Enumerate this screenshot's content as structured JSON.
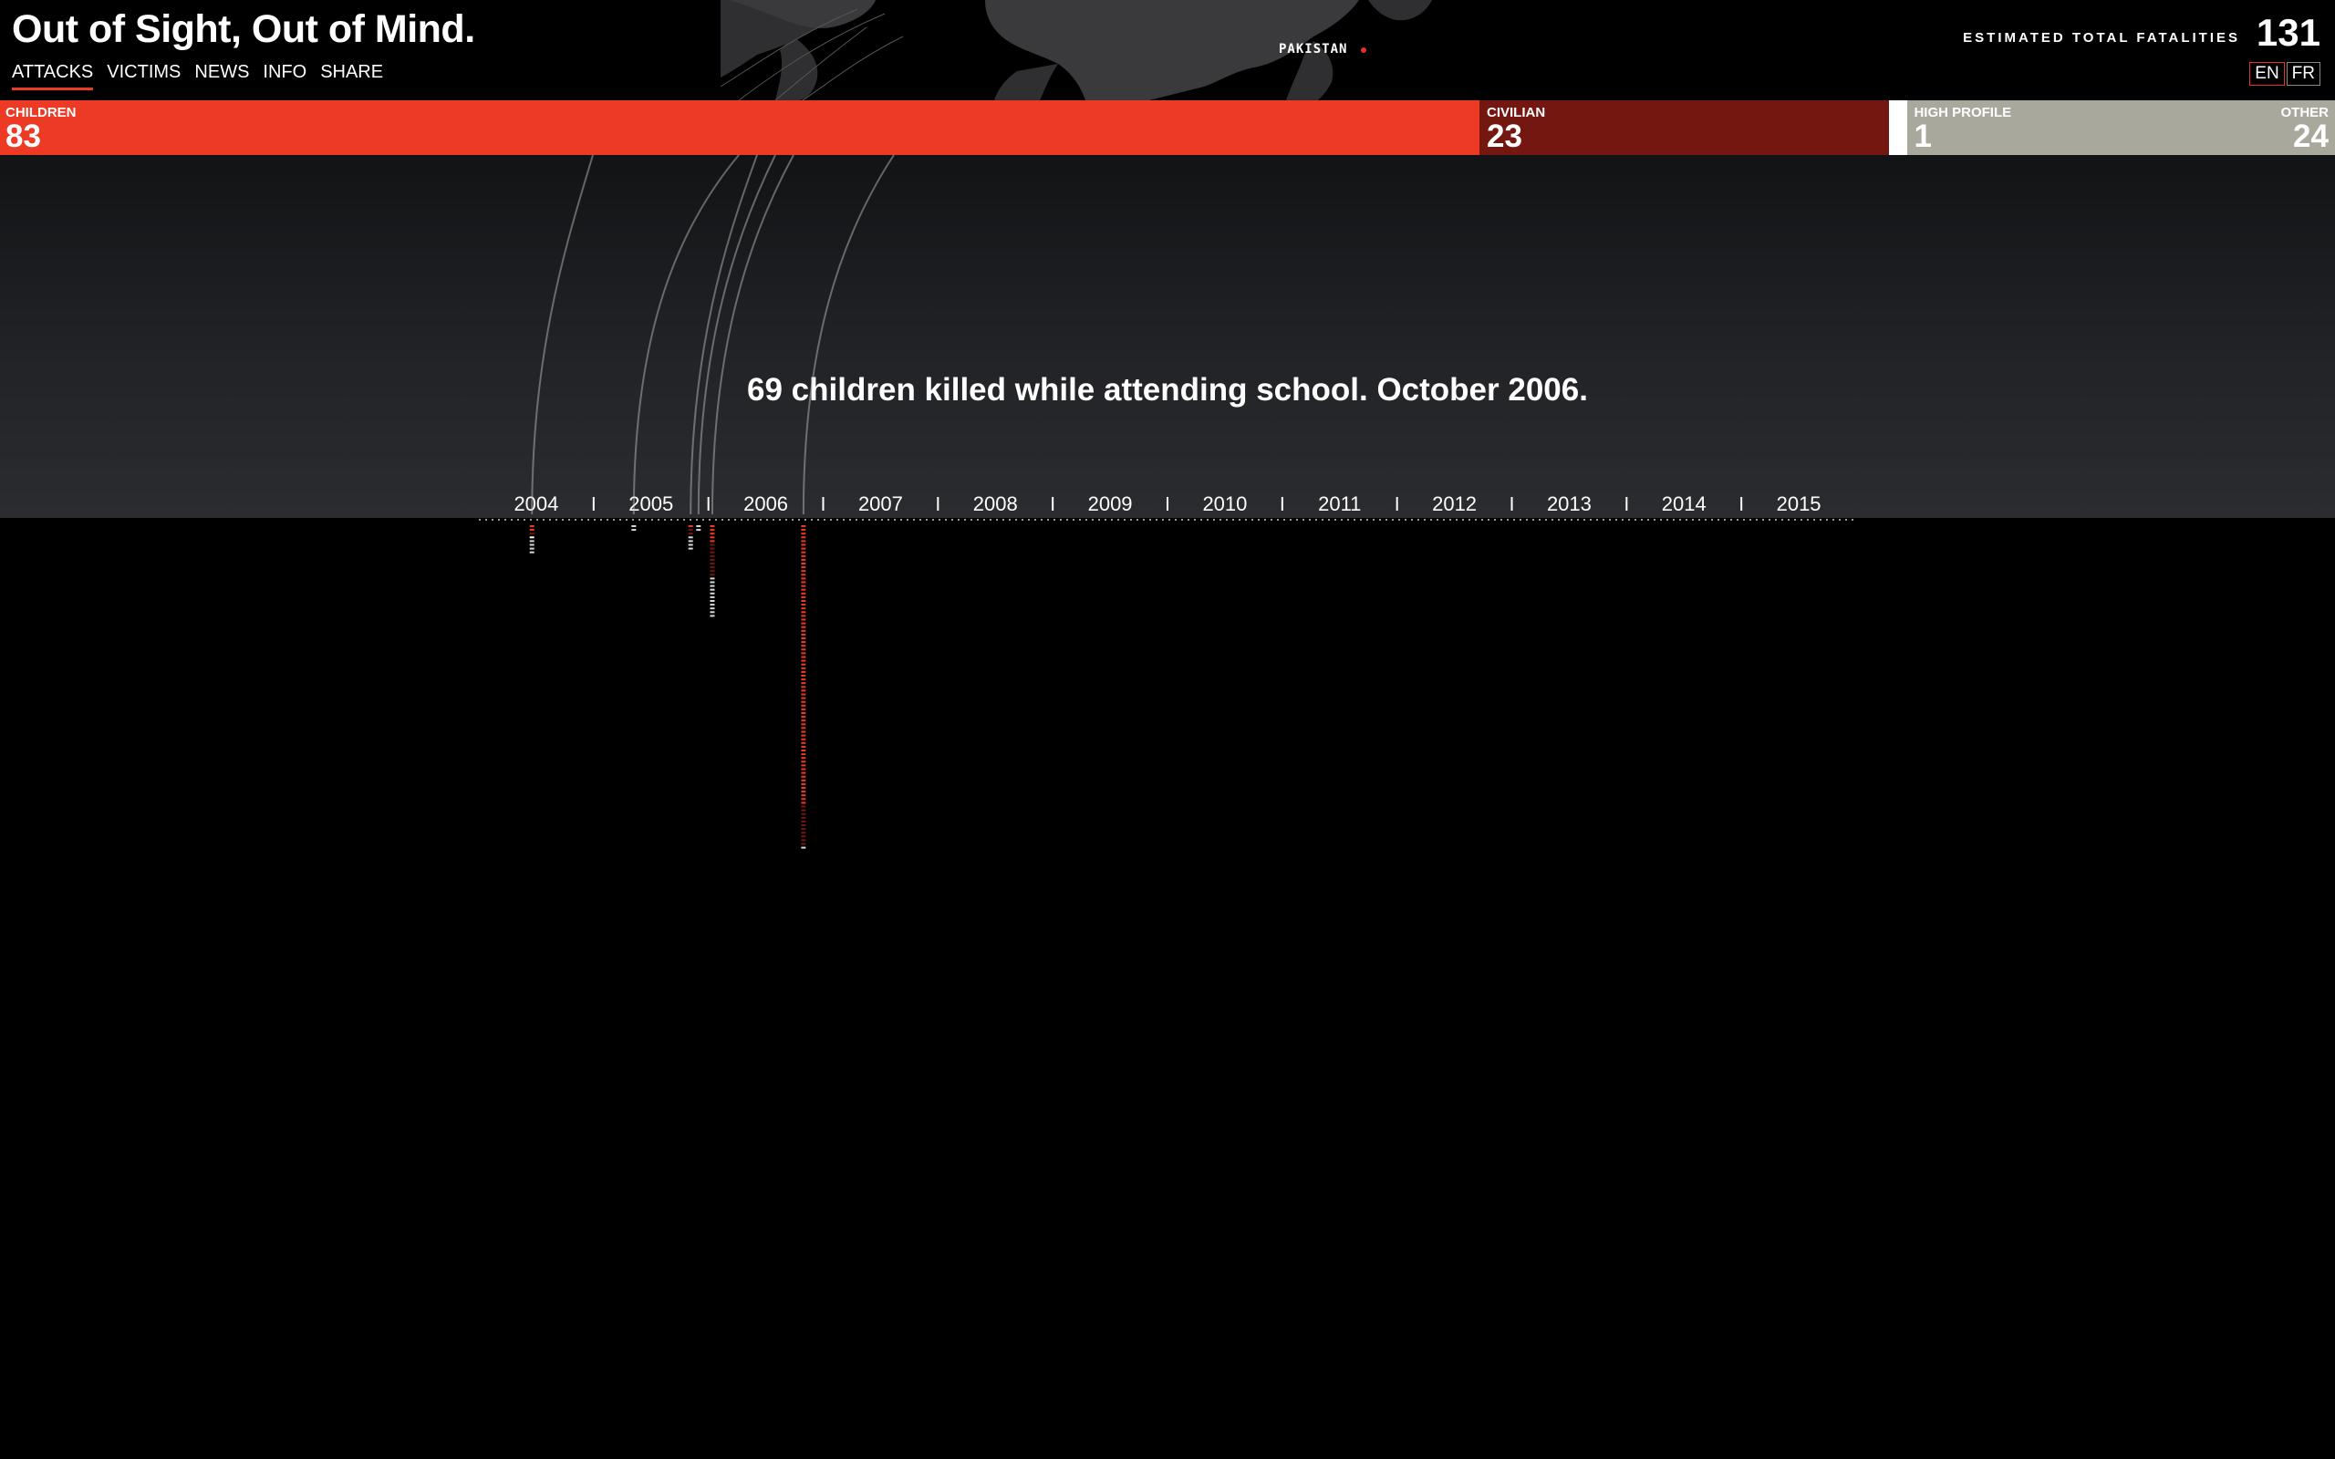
{
  "app": {
    "title": "Out of Sight, Out of Mind."
  },
  "nav": {
    "items": [
      {
        "label": "ATTACKS",
        "active": true
      },
      {
        "label": "VICTIMS",
        "active": false
      },
      {
        "label": "NEWS",
        "active": false
      },
      {
        "label": "INFO",
        "active": false
      },
      {
        "label": "SHARE",
        "active": false
      }
    ]
  },
  "map": {
    "country_label": "PAKISTAN",
    "marker_color": "#e53224"
  },
  "totals": {
    "label": "ESTIMATED TOTAL FATALITIES",
    "value": "131"
  },
  "language": {
    "options": [
      {
        "label": "EN",
        "active": true
      },
      {
        "label": "FR",
        "active": false
      }
    ]
  },
  "categories": [
    {
      "key": "children",
      "label": "CHILDREN",
      "value": 83,
      "color": "#ec3a24"
    },
    {
      "key": "civilian",
      "label": "CIVILIAN",
      "value": 23,
      "color": "#741710"
    },
    {
      "key": "high_profile",
      "label": "HIGH PROFILE",
      "value": 1,
      "color": "#ffffff"
    },
    {
      "key": "other",
      "label": "OTHER",
      "value": 24,
      "color": "#a8a99c"
    }
  ],
  "caption": "69 children killed while attending school. October 2006.",
  "chart_data": {
    "type": "timeline",
    "x_axis_years": [
      "2004",
      "2005",
      "2006",
      "2007",
      "2008",
      "2009",
      "2010",
      "2011",
      "2012",
      "2013",
      "2014",
      "2015"
    ],
    "xlim": [
      "2004-01-01",
      "2016-01-01"
    ],
    "strikes": [
      {
        "date": "2004-06-18",
        "children": 2,
        "civilian": 1,
        "high_profile": 1,
        "other": 4
      },
      {
        "date": "2005-05-08",
        "other": 2
      },
      {
        "date": "2005-11-05",
        "children": 1,
        "civilian": 2,
        "other": 4
      },
      {
        "date": "2005-11-30",
        "other": 2
      },
      {
        "date": "2006-01-13",
        "children": 5,
        "civilian": 9,
        "other": 11
      },
      {
        "date": "2006-10-30",
        "children": 75,
        "civilian": 11,
        "other": 1
      }
    ]
  }
}
